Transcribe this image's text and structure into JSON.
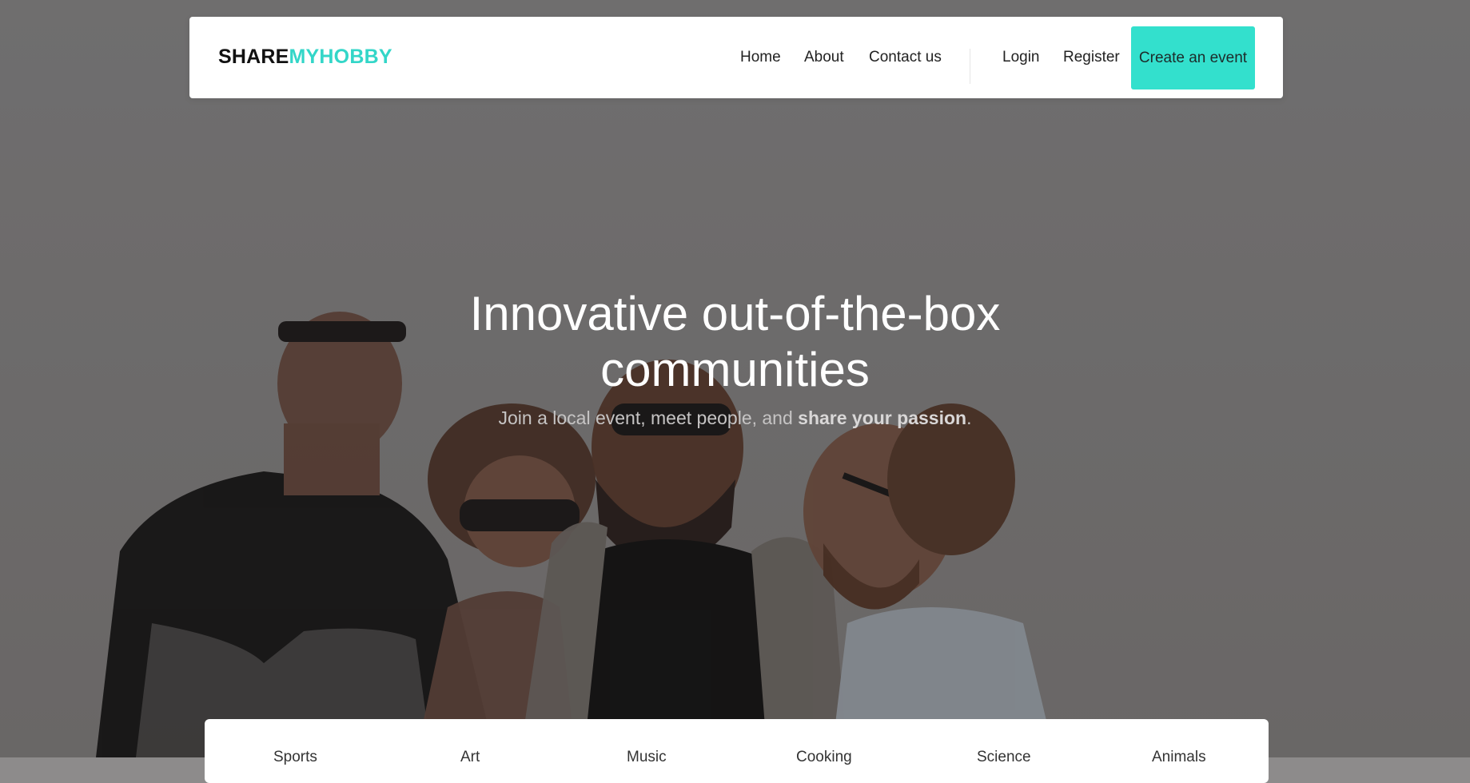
{
  "brand": {
    "part1": "SHARE",
    "part2": "MYHOBBY"
  },
  "nav": {
    "links": [
      "Home",
      "About",
      "Contact us"
    ],
    "login": "Login",
    "register": "Register",
    "cta": "Create an event"
  },
  "hero": {
    "title_line1": "Innovative out-of-the-box",
    "title_line2": "communities",
    "subtitle_pre": "Join a local event, meet people, and ",
    "subtitle_strong": "share your passion",
    "subtitle_post": "."
  },
  "categories": [
    "Sports",
    "Art",
    "Music",
    "Cooking",
    "Science",
    "Animals"
  ],
  "colors": {
    "accent": "#33e0cd",
    "brand_accent": "#33d6c8",
    "overlay": "#8d8b8b"
  }
}
